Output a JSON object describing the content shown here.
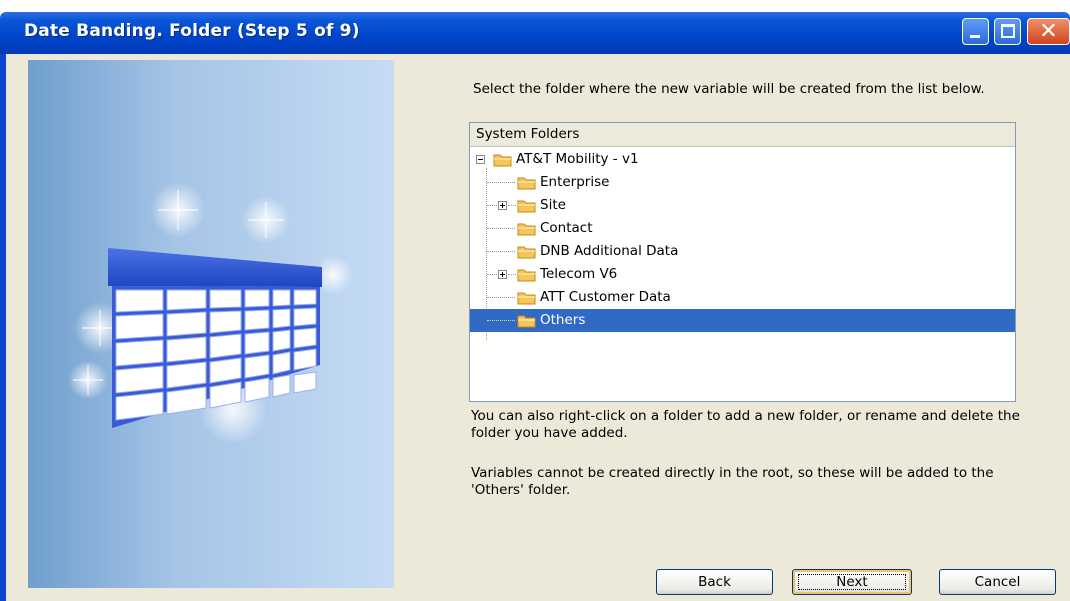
{
  "window": {
    "title": "Date Banding.  Folder (Step 5 of 9)",
    "controls": {
      "minimize_icon": "minimize-icon",
      "maximize_icon": "maximize-icon",
      "close_icon": "close-icon"
    }
  },
  "instruction": "Select the folder where the new variable will be created from the list below.",
  "tree": {
    "header": "System Folders",
    "root": {
      "label": "AT&T Mobility - v1",
      "expanded": true
    },
    "items": [
      {
        "label": "Enterprise",
        "expandable": false
      },
      {
        "label": "Site",
        "expandable": true
      },
      {
        "label": "Contact",
        "expandable": false
      },
      {
        "label": "DNB Additional Data",
        "expandable": false
      },
      {
        "label": "Telecom V6",
        "expandable": true
      },
      {
        "label": "ATT Customer Data",
        "expandable": false
      },
      {
        "label": "Others",
        "expandable": false,
        "selected": true
      }
    ]
  },
  "info": {
    "line1": "You can also right-click on a folder to add a new folder, or rename and delete the folder you have added.",
    "line2": "Variables cannot be created directly in the root, so these will be added to the 'Others' folder."
  },
  "buttons": {
    "back": "Back",
    "next": "Next",
    "cancel": "Cancel"
  },
  "colors": {
    "titlebar": "#0044c9",
    "selection": "#316ac5",
    "dialog_bg": "#ece9d8",
    "folder": "#f4c75a"
  }
}
